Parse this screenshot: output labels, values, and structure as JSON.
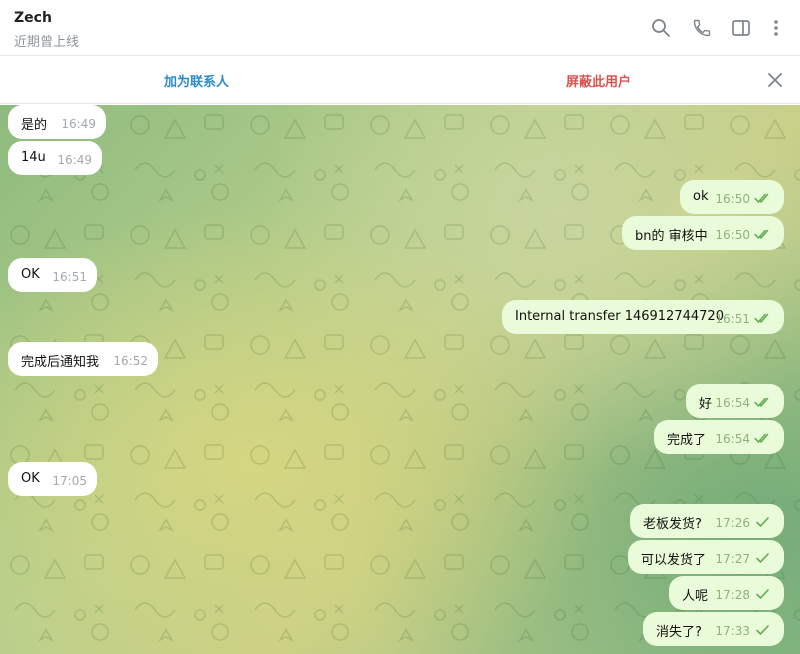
{
  "header": {
    "contact_name": "Zech",
    "status": "近期曾上线"
  },
  "action_bar": {
    "add_contact": "加为联系人",
    "block_user": "屏蔽此用户"
  },
  "messages": [
    {
      "dir": "in",
      "text": "是的",
      "time": "16:49"
    },
    {
      "dir": "in",
      "text": "14u",
      "time": "16:49"
    },
    {
      "dir": "out",
      "text": "ok",
      "time": "16:50",
      "status": "read"
    },
    {
      "dir": "out",
      "text": "bn的 审核中",
      "time": "16:50",
      "status": "read"
    },
    {
      "dir": "in",
      "text": "OK",
      "time": "16:51"
    },
    {
      "dir": "out",
      "text": "Internal transfer 146912744720",
      "time": "16:51",
      "status": "read"
    },
    {
      "dir": "in",
      "text": "完成后通知我",
      "time": "16:52"
    },
    {
      "dir": "out",
      "text": "好",
      "time": "16:54",
      "status": "read"
    },
    {
      "dir": "out",
      "text": "完成了",
      "time": "16:54",
      "status": "read"
    },
    {
      "dir": "in",
      "text": "OK",
      "time": "17:05"
    },
    {
      "dir": "out",
      "text": "老板发货?",
      "time": "17:26",
      "status": "sent"
    },
    {
      "dir": "out",
      "text": "可以发货了",
      "time": "17:27",
      "status": "sent"
    },
    {
      "dir": "out",
      "text": "人呢",
      "time": "17:28",
      "status": "sent"
    },
    {
      "dir": "out",
      "text": "消失了?",
      "time": "17:33",
      "status": "sent"
    }
  ],
  "colors": {
    "link_blue": "#2a8bcf",
    "danger_red": "#d9534f",
    "outgoing_bubble": "#e9fbd8",
    "incoming_bubble": "#ffffff",
    "check_green": "#5fae4f"
  },
  "icons": {
    "header": [
      "search-icon",
      "phone-icon",
      "sidebar-toggle-icon",
      "more-vertical-icon"
    ],
    "action_bar": [
      "close-icon"
    ],
    "message_status": [
      "double-check-icon",
      "single-check-icon"
    ]
  }
}
